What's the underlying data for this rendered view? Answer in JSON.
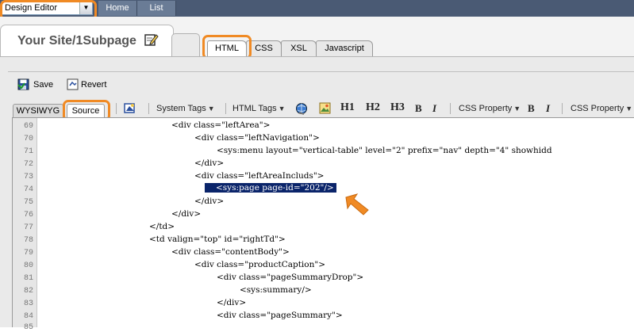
{
  "top": {
    "mode_select_value": "Design Editor",
    "nav": [
      "Home",
      "List"
    ]
  },
  "header": {
    "site_title": "Your Site/1Subpage",
    "tabs": [
      "HTML",
      "CSS",
      "XSL",
      "Javascript"
    ]
  },
  "toolbar": {
    "save_label": "Save",
    "revert_label": "Revert"
  },
  "editor_tabs": [
    "WYSIWYG",
    "Source"
  ],
  "toolbar2": {
    "system_tags": "System Tags",
    "html_tags": "HTML Tags",
    "h1": "H1",
    "h2": "H2",
    "h3": "H3",
    "bold": "B",
    "italic": "I",
    "css_property_1": "CSS Property",
    "css_property_2": "CSS Property"
  },
  "code_lines": [
    {
      "n": "69",
      "text": "<div class=\"leftArea\">"
    },
    {
      "n": "70",
      "text": "<div class=\"leftNavigation\">"
    },
    {
      "n": "71",
      "text": "<sys:menu layout=\"vertical-table\" level=\"2\" prefix=\"nav\" depth=\"4\" showhidd"
    },
    {
      "n": "72",
      "text": "</div>"
    },
    {
      "n": "73",
      "text": "<div class=\"leftAreaIncluds\">"
    },
    {
      "n": "74",
      "text": "<sys:page page-id=\"202\"/>"
    },
    {
      "n": "75",
      "text": "</div>"
    },
    {
      "n": "76",
      "text": "</div>"
    },
    {
      "n": "77",
      "text": "</td>"
    },
    {
      "n": "78",
      "text": "<td valign=\"top\" id=\"rightTd\">"
    },
    {
      "n": "79",
      "text": "<div class=\"contentBody\">"
    },
    {
      "n": "80",
      "text": "<div class=\"productCaption\">"
    },
    {
      "n": "81",
      "text": "<div class=\"pageSummaryDrop\">"
    },
    {
      "n": "82",
      "text": "<sys:summary/>"
    },
    {
      "n": "83",
      "text": "</div>"
    },
    {
      "n": "84",
      "text": "<div class=\"pageSummary\">"
    },
    {
      "n": "85",
      "text": ""
    }
  ],
  "colors": {
    "highlight": "#f08a24",
    "topbar": "#4a5a74",
    "selection": "#0a246a"
  }
}
